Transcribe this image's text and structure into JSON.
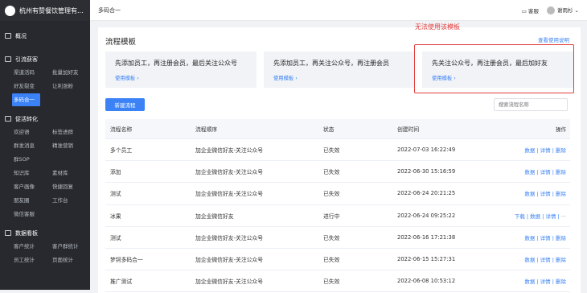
{
  "sidebar": {
    "brand": "杭州有赞餐饮管理有...",
    "overview": "概况",
    "sections": [
      {
        "title": "引流获客",
        "items": [
          "渠道活码",
          "批量加好友",
          "好友裂变",
          "让利涨粉",
          "多码合一"
        ],
        "active": 4
      },
      {
        "title": "促活转化",
        "items": [
          "欢迎语",
          "标签进群",
          "群发消息",
          "精准营销",
          "群SOP",
          "知识库",
          "素材库",
          "客户画像",
          "快捷回复",
          "朋友圈",
          "工作台",
          "微信客服"
        ]
      },
      {
        "title": "数据看板",
        "items": [
          "客户统计",
          "客户群统计",
          "员工统计",
          "页面统计"
        ]
      }
    ]
  },
  "topbar": {
    "crumb": "多码合一",
    "service": "客服",
    "user": "谢雨杉 ⌄"
  },
  "page": {
    "title": "流程模板",
    "help": "查看使用说明",
    "annotation": "无法使用该模板",
    "new_button": "新建流程",
    "search_placeholder": "搜索流程名称"
  },
  "templates": [
    {
      "text": "先添加员工，再注册会员，最后关注公众号",
      "use": "使用模板 ›"
    },
    {
      "text": "先添加员工，再关注公众号，再注册会员",
      "use": "使用模板 ›"
    },
    {
      "text": "先关注公众号，再注册会员，最后加好友",
      "use": "使用模板 ›"
    }
  ],
  "table": {
    "headers": [
      "流程名称",
      "流程顺序",
      "状态",
      "创建时间",
      "操作"
    ],
    "rows": [
      [
        "多个员工",
        "加企业微信好友-关注公众号",
        "已失效",
        "2022-07-03 16:22:49",
        "数据 | 详情 | 删除"
      ],
      [
        "添加",
        "加企业微信好友-关注公众号",
        "已失效",
        "2022-06-30 15:16:59",
        "数据 | 详情 | 删除"
      ],
      [
        "测试",
        "加企业微信好友-关注公众号",
        "已失效",
        "2022-06-24 20:21:25",
        "数据 | 详情 | 删除"
      ],
      [
        "冰果",
        "加企业微信好友",
        "进行中",
        "2022-06-24 09:25:22",
        "下载 | 数据 | 详情 | ···"
      ],
      [
        "测试",
        "加企业微信好友-关注公众号",
        "已失效",
        "2022-06-16 17:21:38",
        "数据 | 详情 | 删除"
      ],
      [
        "梦钶多码合一",
        "加企业微信好友-关注公众号",
        "已失效",
        "2022-06-15 15:27:31",
        "数据 | 详情 | 删除"
      ],
      [
        "推广测试",
        "加企业微信好友-关注公众号",
        "已失效",
        "2022-06-08 10:53:12",
        "数据 | 详情 | 删除"
      ]
    ]
  }
}
